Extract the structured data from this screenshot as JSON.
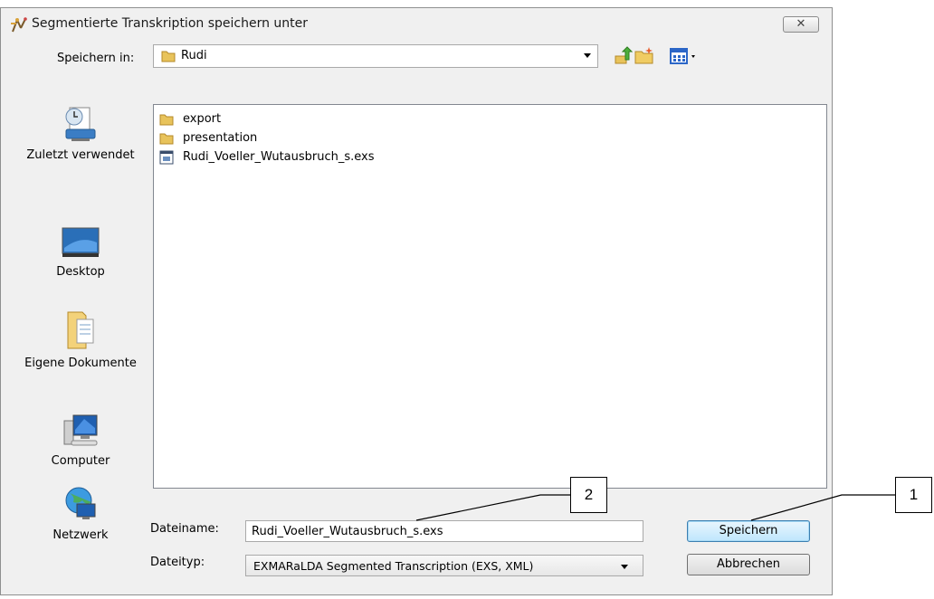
{
  "dialog": {
    "title": "Segmentierte Transkription speichern unter",
    "close_symbol": "✕",
    "lookin": {
      "label": "Speichern in:",
      "value": "Rudi"
    },
    "places": [
      {
        "label": "Zuletzt verwendet",
        "icon": "recent-places-icon"
      },
      {
        "label": "Desktop",
        "icon": "desktop-icon"
      },
      {
        "label": "Eigene Dokumente",
        "icon": "documents-icon"
      },
      {
        "label": "Computer",
        "icon": "computer-icon"
      },
      {
        "label": "Netzwerk",
        "icon": "network-icon"
      }
    ],
    "files": [
      {
        "name": "export",
        "type": "folder"
      },
      {
        "name": "presentation",
        "type": "folder"
      },
      {
        "name": "Rudi_Voeller_Wutausbruch_s.exs",
        "type": "file"
      }
    ],
    "filename": {
      "label": "Dateiname:",
      "value": "Rudi_Voeller_Wutausbruch_s.exs"
    },
    "filetype": {
      "label": "Dateityp:",
      "value": "EXMARaLDA Segmented Transcription (EXS, XML)"
    },
    "buttons": {
      "save": "Speichern",
      "cancel": "Abbrechen"
    }
  },
  "callouts": {
    "one": "1",
    "two": "2"
  },
  "colors": {
    "dialog_bg": "#f0f0f0",
    "save_border": "#3c7fb1",
    "folder": "#e8c35b"
  }
}
